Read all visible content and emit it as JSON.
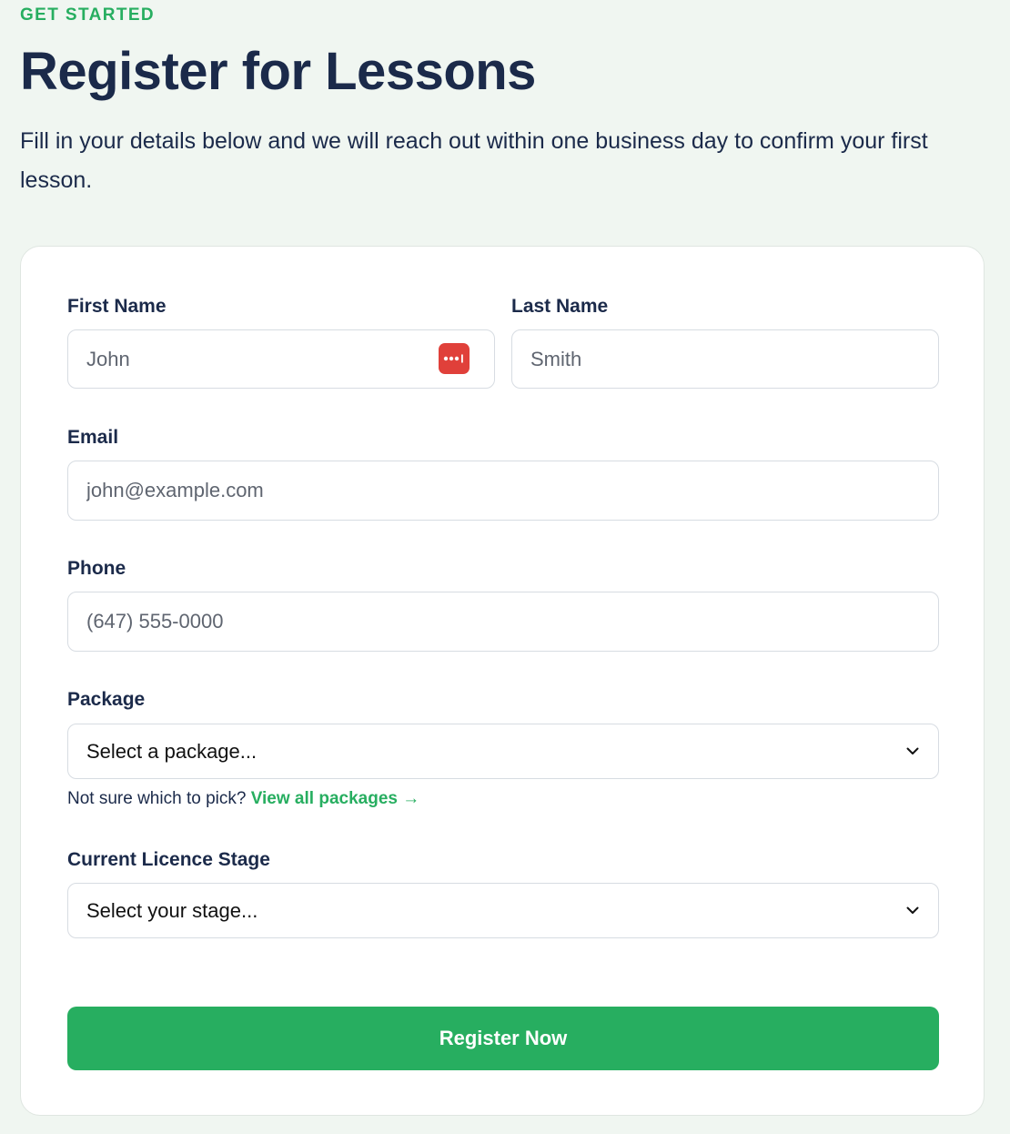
{
  "header": {
    "eyebrow": "GET STARTED",
    "title": "Register for Lessons",
    "intro": "Fill in your details below and we will reach out within one business day to confirm your first lesson."
  },
  "form": {
    "first_name": {
      "label": "First Name",
      "placeholder": "John",
      "value": ""
    },
    "last_name": {
      "label": "Last Name",
      "placeholder": "Smith",
      "value": ""
    },
    "email": {
      "label": "Email",
      "placeholder": "john@example.com",
      "value": ""
    },
    "phone": {
      "label": "Phone",
      "placeholder": "(647) 555-0000",
      "value": ""
    },
    "package": {
      "label": "Package",
      "selected": "Select a package...",
      "helper_text": "Not sure which to pick?",
      "helper_link": "View all packages →"
    },
    "licence_stage": {
      "label": "Current Licence Stage",
      "selected": "Select your stage..."
    },
    "submit_label": "Register Now"
  },
  "icons": {
    "password_manager": "password-manager-icon",
    "chevron": "chevron-down-icon"
  },
  "colors": {
    "accent": "#27ae60",
    "heading": "#1b2a4a",
    "background": "#f0f6f1",
    "password_manager": "#e0403a"
  }
}
